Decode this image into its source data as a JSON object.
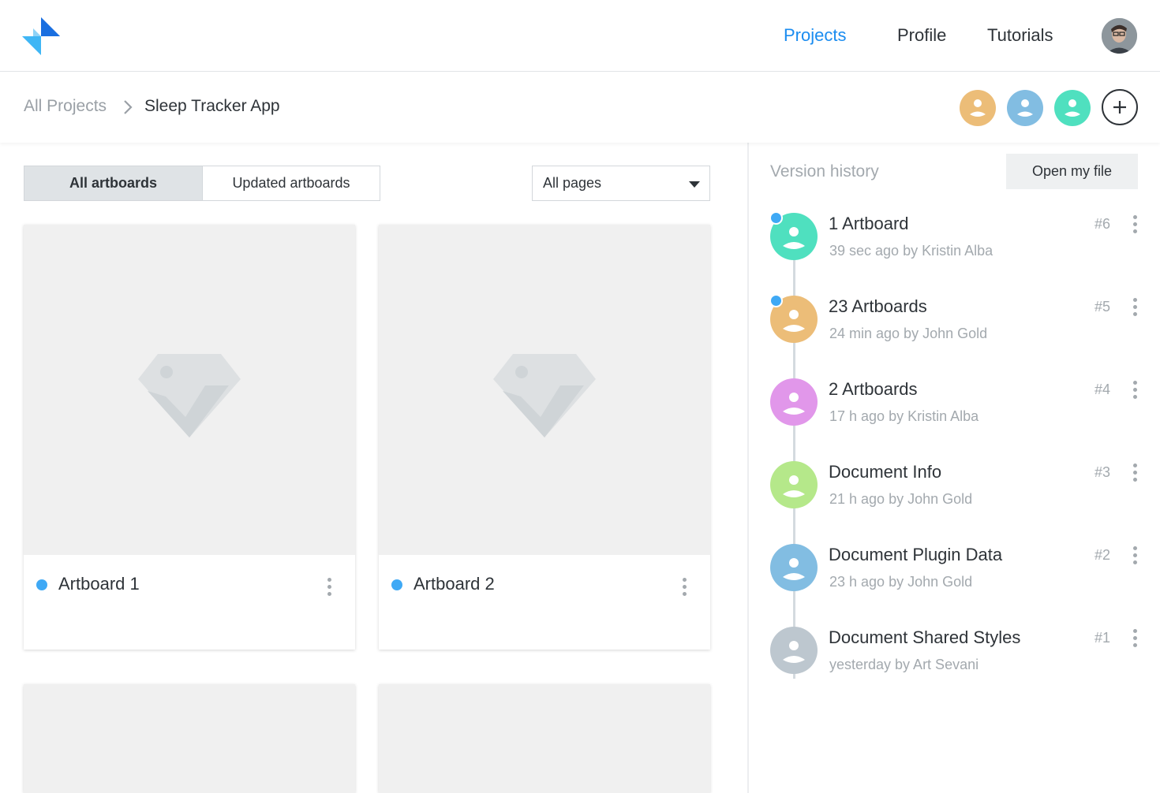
{
  "nav": {
    "links": [
      "Projects",
      "Profile",
      "Tutorials"
    ],
    "active": "Projects"
  },
  "icons": {
    "logo": "logo-icon",
    "user_avatar": "user-avatar",
    "chevron": "chevron-right-icon",
    "add": "plus-icon",
    "placeholder": "sketch-diamond-icon",
    "more": "more-vertical-icon"
  },
  "colors": {
    "accent": "#1a8cf0",
    "new_dot": "#3fa9f5",
    "collaborators": [
      "#ecbd78",
      "#82bde2",
      "#4fe0bf"
    ]
  },
  "breadcrumb": {
    "root": "All Projects",
    "current": "Sleep Tracker App"
  },
  "filters": {
    "tabs": [
      "All artboards",
      "Updated artboards"
    ],
    "active_tab": "All artboards",
    "page_select": "All pages"
  },
  "artboards": [
    {
      "name": "Artboard 1",
      "updated": true
    },
    {
      "name": "Artboard 2",
      "updated": true
    },
    {
      "name": "",
      "updated": false
    },
    {
      "name": "",
      "updated": false
    }
  ],
  "version_history": {
    "title": "Version history",
    "open_button": "Open my file",
    "versions": [
      {
        "title": "1 Artboard",
        "meta": "39 sec ago by Kristin Alba",
        "number": "#6",
        "color": "#4fe0bf",
        "new": true
      },
      {
        "title": "23 Artboards",
        "meta": "24 min ago by John Gold",
        "number": "#5",
        "color": "#ecbd78",
        "new": true
      },
      {
        "title": "2 Artboards",
        "meta": "17 h ago by Kristin Alba",
        "number": "#4",
        "color": "#e197ea",
        "new": false
      },
      {
        "title": "Document Info",
        "meta": "21 h ago by John Gold",
        "number": "#3",
        "color": "#b5e88a",
        "new": false
      },
      {
        "title": "Document Plugin Data",
        "meta": "23 h ago by John Gold",
        "number": "#2",
        "color": "#82bde2",
        "new": false
      },
      {
        "title": "Document Shared Styles",
        "meta": "yesterday by Art Sevani",
        "number": "#1",
        "color": "#bdc7cf",
        "new": false
      }
    ]
  }
}
